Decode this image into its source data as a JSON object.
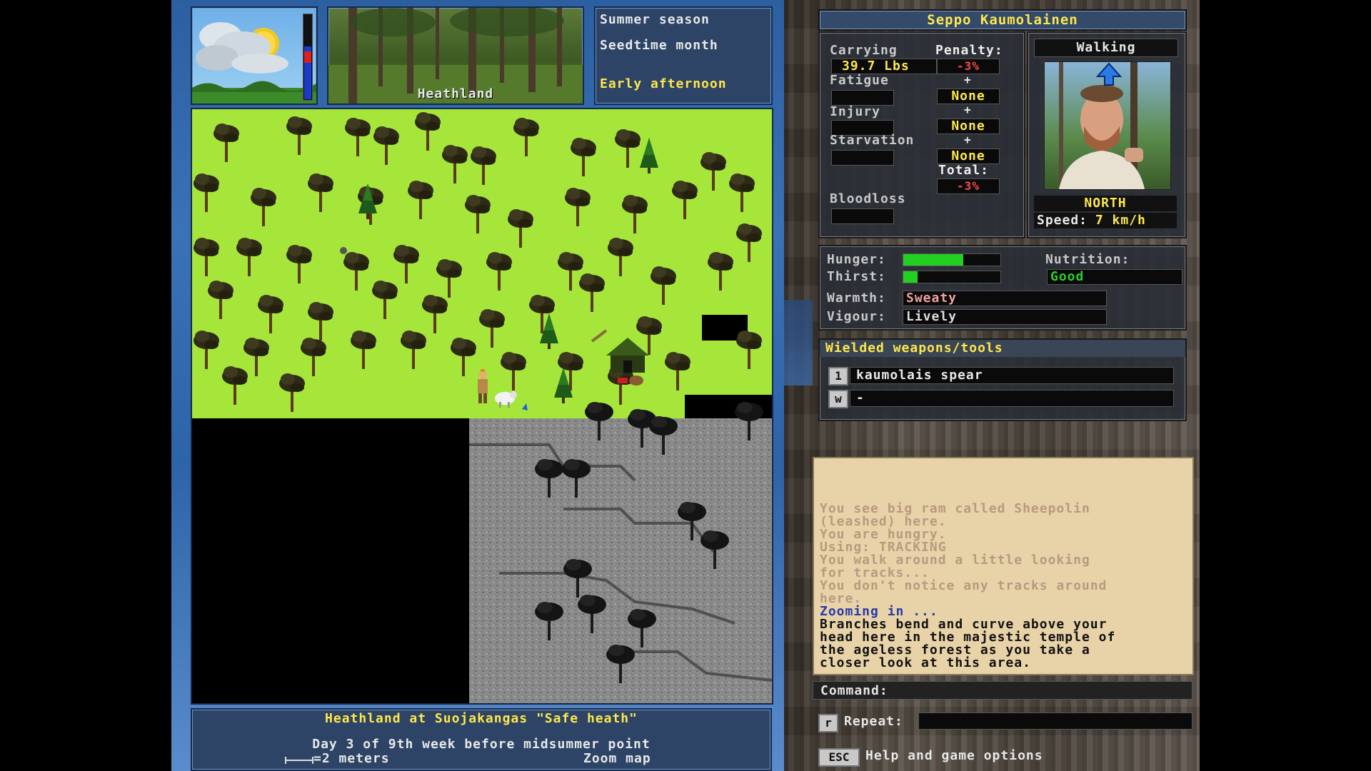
{
  "header": {
    "season": "Summer season",
    "month": "Seedtime month",
    "time_of_day": "Early afternoon",
    "terrain_label": "Heathland"
  },
  "map": {
    "location_title": "Heathland at Suojakangas \"Safe heath\"",
    "date_line": "Day 3 of 9th week before midsummer point",
    "scale_label": "=2 meters",
    "zoom_label": "Zoom map"
  },
  "character": {
    "name": "Seppo Kaumolainen",
    "movement": "Walking",
    "facing": "NORTH",
    "speed_label": "Speed:",
    "speed_value": "7 km/h"
  },
  "status": {
    "carrying_label": "Carrying",
    "carrying_value": "39.7 Lbs",
    "penalty_label": "Penalty:",
    "penalty_value": "-3%",
    "fatigue_label": "Fatigue",
    "fatigue_value": "None",
    "injury_label": "Injury",
    "injury_value": "None",
    "starvation_label": "Starvation",
    "starvation_value": "None",
    "total_label": "Total:",
    "total_value": "-3%",
    "bloodloss_label": "Bloodloss",
    "plus": "+"
  },
  "needs": {
    "hunger_label": "Hunger:",
    "hunger_level": 0.62,
    "thirst_label": "Thirst:",
    "thirst_level": 0.15,
    "nutrition_label": "Nutrition:",
    "nutrition_value": "Good",
    "warmth_label": "Warmth:",
    "warmth_value": "Sweaty",
    "vigour_label": "Vigour:",
    "vigour_value": "Lively"
  },
  "weapons": {
    "title": "Wielded weapons/tools",
    "slots": [
      {
        "key": "1",
        "value": "kaumolais spear"
      },
      {
        "key": "w",
        "value": "-"
      }
    ]
  },
  "log": {
    "lines": [
      {
        "text": "You see big ram called Sheepolin",
        "style": "old"
      },
      {
        "text": "(leashed) here.",
        "style": "old"
      },
      {
        "text": "You are hungry.",
        "style": "old"
      },
      {
        "text": "Using: TRACKING",
        "style": "old"
      },
      {
        "text": "You walk around a little looking",
        "style": "old"
      },
      {
        "text": "for tracks...",
        "style": "old"
      },
      {
        "text": "You don't notice any tracks around",
        "style": "old"
      },
      {
        "text": "here.",
        "style": "old"
      },
      {
        "text": "Zooming in ...",
        "style": "blue"
      },
      {
        "text": "Branches bend and curve above your",
        "style": "new"
      },
      {
        "text": "head here in the majestic temple of",
        "style": "new"
      },
      {
        "text": "the ageless forest as you take a",
        "style": "new"
      },
      {
        "text": "closer look at this area.",
        "style": "new"
      }
    ]
  },
  "command": {
    "label": "Command:",
    "repeat_key": "r",
    "repeat_label": "Repeat:",
    "esc_key": "ESC",
    "help_label": "Help and game options"
  },
  "colors": {
    "grass": "#a6e63a",
    "penalty_red": "#ff4a4a",
    "highlight_yellow": "#ffe84a",
    "bar_green": "#22d022",
    "log_bg": "#e8d2a8"
  }
}
